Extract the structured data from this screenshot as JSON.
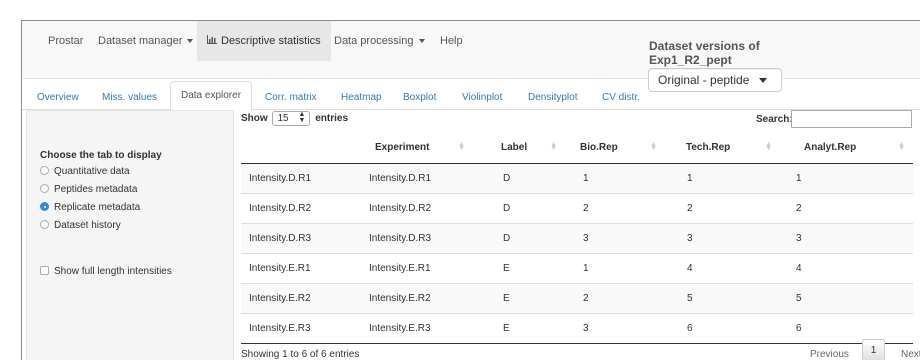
{
  "navbar": {
    "items": [
      {
        "label": "Prostar",
        "dropdown": false
      },
      {
        "label": "Dataset manager",
        "dropdown": true
      },
      {
        "label": "Descriptive statistics",
        "icon": "bar-chart-icon",
        "active": true
      },
      {
        "label": "Data processing",
        "dropdown": true
      },
      {
        "label": "Help",
        "dropdown": false
      }
    ],
    "versions_title": "Dataset versions of Exp1_R2_pept",
    "versions_selected": "Original - peptide"
  },
  "tabs": [
    {
      "label": "Overview"
    },
    {
      "label": "Miss. values"
    },
    {
      "label": "Data explorer",
      "active": true
    },
    {
      "label": "Corr. matrix"
    },
    {
      "label": "Heatmap"
    },
    {
      "label": "Boxplot"
    },
    {
      "label": "Violinplot"
    },
    {
      "label": "Densityplot"
    },
    {
      "label": "CV distr."
    }
  ],
  "sidebar": {
    "heading": "Choose the tab to display",
    "options": [
      {
        "label": "Quantitative data",
        "checked": false
      },
      {
        "label": "Peptides metadata",
        "checked": false
      },
      {
        "label": "Replicate metadata",
        "checked": true
      },
      {
        "label": "Dataset history",
        "checked": false
      }
    ],
    "checkbox_label": "Show full length intensities",
    "checkbox_checked": false
  },
  "table": {
    "show_prefix": "Show",
    "show_value": "15",
    "show_suffix": "entries",
    "search_label": "Search:",
    "search_value": "",
    "columns": [
      "",
      "Experiment",
      "Label",
      "Bio.Rep",
      "Tech.Rep",
      "Analyt.Rep"
    ],
    "rows": [
      [
        "Intensity.D.R1",
        "Intensity.D.R1",
        "D",
        "1",
        "1",
        "1"
      ],
      [
        "Intensity.D.R2",
        "Intensity.D.R2",
        "D",
        "2",
        "2",
        "2"
      ],
      [
        "Intensity.D.R3",
        "Intensity.D.R3",
        "D",
        "3",
        "3",
        "3"
      ],
      [
        "Intensity.E.R1",
        "Intensity.E.R1",
        "E",
        "1",
        "4",
        "4"
      ],
      [
        "Intensity.E.R2",
        "Intensity.E.R2",
        "E",
        "2",
        "5",
        "5"
      ],
      [
        "Intensity.E.R3",
        "Intensity.E.R3",
        "E",
        "3",
        "6",
        "6"
      ]
    ],
    "info": "Showing 1 to 6 of 6 entries",
    "pagination": {
      "previous": "Previous",
      "current": "1",
      "next": "Next"
    }
  },
  "colors": {
    "link": "#337ab7",
    "radio_checked": "#2d88e8"
  }
}
